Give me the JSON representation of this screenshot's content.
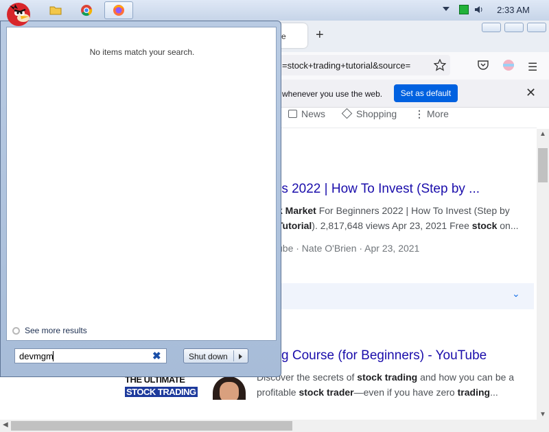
{
  "taskbar": {
    "clock": "2:33 AM",
    "apps": [
      "file-explorer-icon",
      "chrome-icon",
      "firefox-icon"
    ]
  },
  "browser": {
    "tab_fragment": "e",
    "url_fragment": "=stock+trading+tutorial&source=",
    "notification_text": "whenever you use the web.",
    "set_default_label": "Set as default",
    "google_tabs": [
      "News",
      "Shopping",
      "More"
    ],
    "results_count_fragment": ")",
    "result1": {
      "title": "rs 2022 | How To Invest (Step by ...",
      "snippet_line1_b1": "k Market",
      "snippet_line1_rest": " For Beginners 2022 | How To Invest (Step by",
      "snippet_line2_b1": "Tutorial",
      "snippet_line2_mid": "). 2,817,648 views Apr 23, 2021 Free ",
      "snippet_line2_b2": "stock",
      "snippet_line2_end": " on...",
      "meta": "ube · Nate O'Brien · Apr 23, 2021"
    },
    "result2": {
      "title": "g Course (for Beginners) - YouTube",
      "snippet_line1_a": "Discover the secrets of ",
      "snippet_line1_b": "stock trading",
      "snippet_line1_c": " and how you can be a",
      "snippet_line2_a": "profitable ",
      "snippet_line2_b": "stock trader",
      "snippet_line2_c": "—even if you have zero ",
      "snippet_line2_d": "trading",
      "snippet_line2_e": "...",
      "thumb_line1": "THE ULTIMATE",
      "thumb_line2": "STOCK TRADING"
    }
  },
  "start_menu": {
    "no_items_text": "No items match your search.",
    "see_more_label": "See more results",
    "search_value": "devmgm",
    "shutdown_label": "Shut down"
  },
  "colors": {
    "accent_button": "#0061e0",
    "link": "#1a0dab"
  }
}
